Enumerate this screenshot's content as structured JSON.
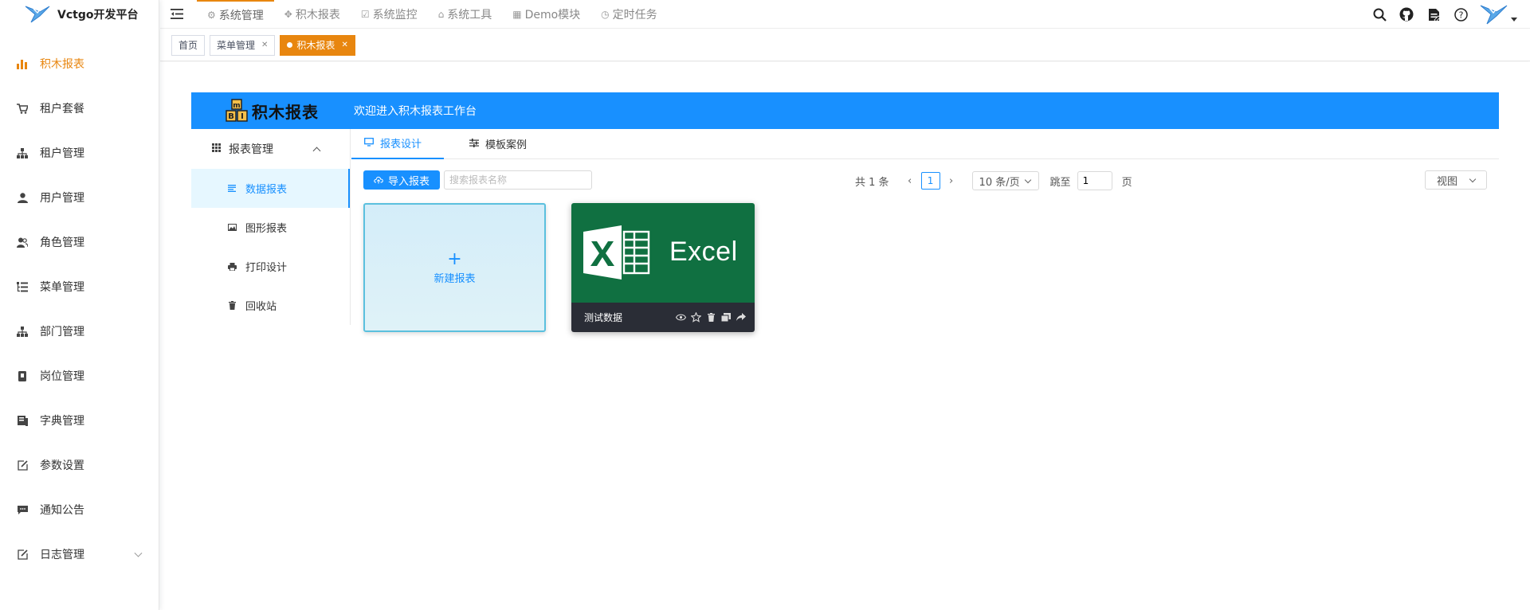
{
  "app": {
    "title": "Vctgo开发平台"
  },
  "colors": {
    "accent": "#e8860f",
    "primary": "#1890ff",
    "excel_green": "#107041",
    "card_footer": "#2a2d36"
  },
  "sidebar": {
    "items": [
      {
        "label": "积木报表",
        "icon": "bar-chart-icon",
        "active": true
      },
      {
        "label": "租户套餐",
        "icon": "cart-icon"
      },
      {
        "label": "租户管理",
        "icon": "org-tree-icon"
      },
      {
        "label": "用户管理",
        "icon": "user-icon"
      },
      {
        "label": "角色管理",
        "icon": "peoples-icon"
      },
      {
        "label": "菜单管理",
        "icon": "tree-list-icon"
      },
      {
        "label": "部门管理",
        "icon": "org-tree-icon"
      },
      {
        "label": "岗位管理",
        "icon": "post-icon"
      },
      {
        "label": "字典管理",
        "icon": "dict-icon"
      },
      {
        "label": "参数设置",
        "icon": "edit-icon"
      },
      {
        "label": "通知公告",
        "icon": "message-icon"
      },
      {
        "label": "日志管理",
        "icon": "log-icon",
        "expandable": true
      }
    ]
  },
  "header": {
    "menus": [
      {
        "label": "系统管理",
        "icon": "gear-icon"
      },
      {
        "label": "积木报表",
        "icon": "move-icon"
      },
      {
        "label": "系统监控",
        "icon": "monitor-icon"
      },
      {
        "label": "系统工具",
        "icon": "toolbox-icon"
      },
      {
        "label": "Demo模块",
        "icon": "grid-icon"
      },
      {
        "label": "定时任务",
        "icon": "clock-icon"
      }
    ],
    "right_icons": [
      "search-icon",
      "github-icon",
      "document-icon",
      "question-icon"
    ]
  },
  "tags": [
    {
      "label": "首页",
      "closable": false
    },
    {
      "label": "菜单管理",
      "closable": true
    },
    {
      "label": "积木报表",
      "closable": true,
      "active": true
    }
  ],
  "banner": {
    "logo_letters": [
      "m",
      "B",
      "I"
    ],
    "title": "积木报表",
    "welcome": "欢迎进入积木报表工作台"
  },
  "inner_menu": {
    "group": "报表管理",
    "items": [
      {
        "label": "数据报表",
        "icon": "list-lines-icon",
        "selected": true
      },
      {
        "label": "图形报表",
        "icon": "image-icon"
      },
      {
        "label": "打印设计",
        "icon": "printer-icon"
      },
      {
        "label": "回收站",
        "icon": "trash-icon"
      }
    ]
  },
  "tabs": [
    {
      "label": "报表设计",
      "icon": "desktop-icon",
      "active": true
    },
    {
      "label": "模板案例",
      "icon": "sliders-icon"
    }
  ],
  "toolbar": {
    "import_label": "导入报表",
    "search_placeholder": "搜索报表名称",
    "total": "共 1 条",
    "current_page": "1",
    "page_size": "10 条/页",
    "jump_label": "跳至",
    "jump_value": "1",
    "page_unit": "页",
    "view_label": "视图"
  },
  "cards": {
    "new_label": "新建报表",
    "new_plus": "+",
    "excel_brand": "Excel",
    "excel_name": "测试数据"
  }
}
